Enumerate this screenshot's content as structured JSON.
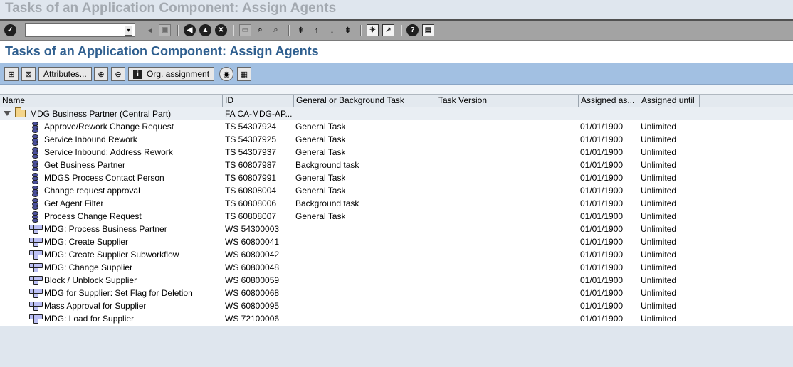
{
  "window": {
    "title": "Tasks of an Application Component: Assign Agents"
  },
  "system_toolbar": {
    "command_field_value": "",
    "icons": [
      "enter-icon",
      "save-icon",
      "back-icon",
      "exit-icon",
      "cancel-icon",
      "print-icon",
      "find-icon",
      "find-next-icon",
      "first-page-icon",
      "previous-page-icon",
      "next-page-icon",
      "last-page-icon",
      "new-session-icon",
      "shortcut-icon",
      "help-icon",
      "customize-layout-icon"
    ]
  },
  "screen": {
    "title": "Tasks of an Application Component: Assign Agents"
  },
  "app_toolbar": {
    "attributes_label": "Attributes...",
    "org_assignment_label": "Org. assignment"
  },
  "columns": {
    "name": "Name",
    "id": "ID",
    "task_type": "General or Background Task",
    "task_version": "Task Version",
    "assigned_as_of": "Assigned as...",
    "assigned_until": "Assigned until"
  },
  "group": {
    "name": "MDG Business Partner (Central Part)",
    "id": "FA CA-MDG-AP..."
  },
  "rows": [
    {
      "name": "Approve/Rework Change Request",
      "id": "TS 54307924",
      "type": "General Task",
      "from": "01/01/1900",
      "until": "Unlimited",
      "kind": "task"
    },
    {
      "name": "Service Inbound Rework",
      "id": "TS 54307925",
      "type": "General Task",
      "from": "01/01/1900",
      "until": "Unlimited",
      "kind": "task"
    },
    {
      "name": "Service Inbound: Address Rework",
      "id": "TS 54307937",
      "type": "General Task",
      "from": "01/01/1900",
      "until": "Unlimited",
      "kind": "task"
    },
    {
      "name": "Get Business Partner",
      "id": "TS 60807987",
      "type": "Background task",
      "from": "01/01/1900",
      "until": "Unlimited",
      "kind": "task"
    },
    {
      "name": "MDGS Process Contact Person",
      "id": "TS 60807991",
      "type": "General Task",
      "from": "01/01/1900",
      "until": "Unlimited",
      "kind": "task"
    },
    {
      "name": "Change request approval",
      "id": "TS 60808004",
      "type": "General Task",
      "from": "01/01/1900",
      "until": "Unlimited",
      "kind": "task"
    },
    {
      "name": "Get Agent Filter",
      "id": "TS 60808006",
      "type": "Background task",
      "from": "01/01/1900",
      "until": "Unlimited",
      "kind": "task"
    },
    {
      "name": "Process Change Request",
      "id": "TS 60808007",
      "type": "General Task",
      "from": "01/01/1900",
      "until": "Unlimited",
      "kind": "task"
    },
    {
      "name": "MDG: Process Business Partner",
      "id": "WS 54300003",
      "type": "",
      "from": "01/01/1900",
      "until": "Unlimited",
      "kind": "workflow"
    },
    {
      "name": "MDG: Create Supplier",
      "id": "WS 60800041",
      "type": "",
      "from": "01/01/1900",
      "until": "Unlimited",
      "kind": "workflow"
    },
    {
      "name": "MDG: Create Supplier Subworkflow",
      "id": "WS 60800042",
      "type": "",
      "from": "01/01/1900",
      "until": "Unlimited",
      "kind": "workflow"
    },
    {
      "name": "MDG: Change Supplier",
      "id": "WS 60800048",
      "type": "",
      "from": "01/01/1900",
      "until": "Unlimited",
      "kind": "workflow"
    },
    {
      "name": "Block / Unblock Supplier",
      "id": "WS 60800059",
      "type": "",
      "from": "01/01/1900",
      "until": "Unlimited",
      "kind": "workflow"
    },
    {
      "name": "MDG for Supplier: Set Flag for Deletion",
      "id": "WS 60800068",
      "type": "",
      "from": "01/01/1900",
      "until": "Unlimited",
      "kind": "workflow"
    },
    {
      "name": "Mass Approval for Supplier",
      "id": "WS 60800095",
      "type": "",
      "from": "01/01/1900",
      "until": "Unlimited",
      "kind": "workflow"
    },
    {
      "name": "MDG: Load for Supplier",
      "id": "WS 72100006",
      "type": "",
      "from": "01/01/1900",
      "until": "Unlimited",
      "kind": "workflow"
    }
  ]
}
